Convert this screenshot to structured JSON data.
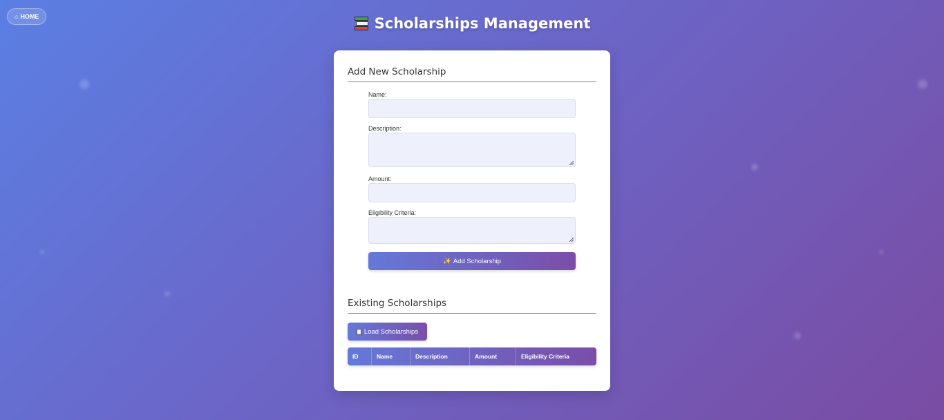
{
  "nav": {
    "home_label": "HOME",
    "home_icon": "home-icon"
  },
  "page": {
    "title": "Scholarships Management",
    "title_icon": "books-icon"
  },
  "add_form": {
    "heading": "Add New Scholarship",
    "name_label": "Name:",
    "name_value": "",
    "description_label": "Description:",
    "description_value": "",
    "amount_label": "Amount:",
    "amount_value": "",
    "eligibility_label": "Eligibility Criteria:",
    "eligibility_value": "",
    "submit_label": "Add Scholarship",
    "submit_icon": "sparkle-icon"
  },
  "existing": {
    "heading": "Existing Scholarships",
    "load_label": "Load Scholarships",
    "load_icon": "clipboard-icon",
    "columns": [
      "ID",
      "Name",
      "Description",
      "Amount",
      "Eligibility Criteria"
    ],
    "rows": []
  },
  "colors": {
    "accent_start": "#6479d9",
    "accent_end": "#7a4ea8",
    "background_start": "#5b7fe3",
    "background_end": "#7a4ca3"
  }
}
